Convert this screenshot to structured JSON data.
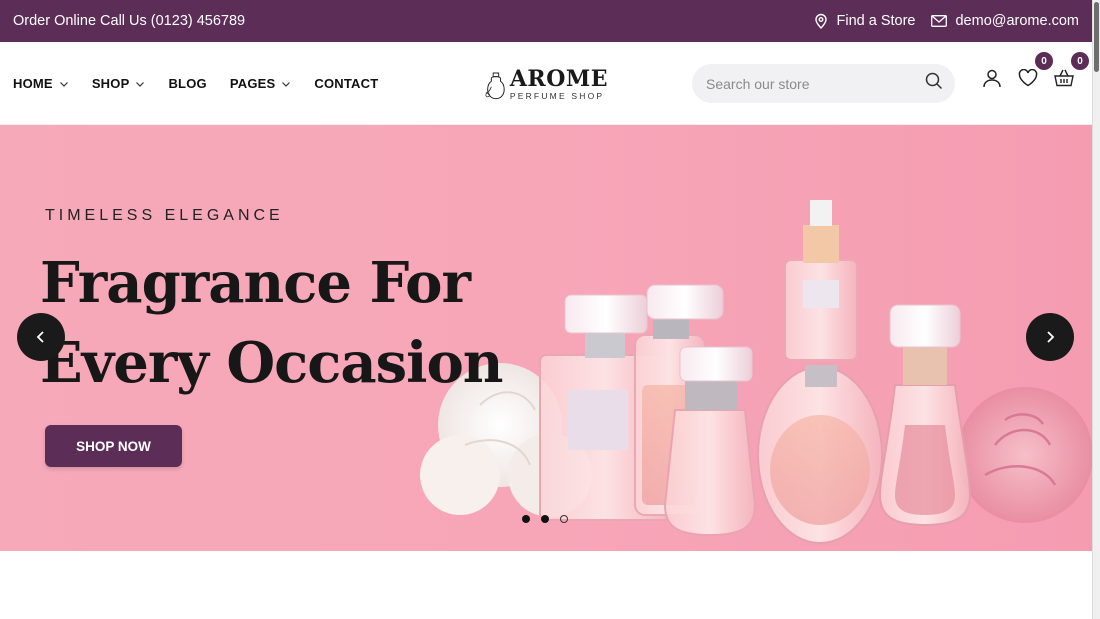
{
  "topbar": {
    "order_text": "Order Online Call Us (0123) 456789",
    "store_label": "Find a Store",
    "email": "demo@arome.com"
  },
  "nav": {
    "items": [
      {
        "label": "HOME",
        "dropdown": true
      },
      {
        "label": "SHOP",
        "dropdown": true
      },
      {
        "label": "BLOG",
        "dropdown": false
      },
      {
        "label": "PAGES",
        "dropdown": true
      },
      {
        "label": "CONTACT",
        "dropdown": false
      }
    ]
  },
  "logo": {
    "name": "AROME",
    "tagline": "PERFUME SHOP"
  },
  "search": {
    "placeholder": "Search our store",
    "icon": "search-icon"
  },
  "header_icons": {
    "account_icon": "user-icon",
    "wishlist_count": "0",
    "cart_count": "0"
  },
  "hero": {
    "kicker": "TIMELESS ELEGANCE",
    "headline_line1": "Fragrance For",
    "headline_line2": "Every Occasion",
    "cta": "SHOP NOW",
    "slides_total": 3,
    "active_slide": 2
  },
  "colors": {
    "brand": "#5c2d57",
    "hero_bg": "#f7a6b8",
    "dark": "#1a1a1a"
  }
}
